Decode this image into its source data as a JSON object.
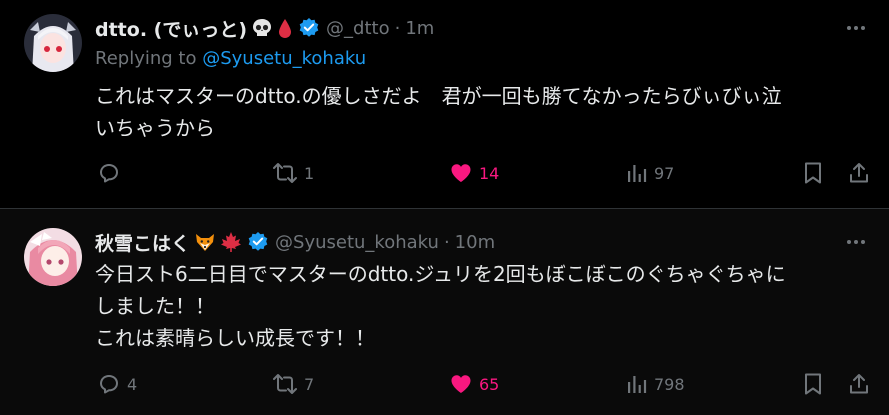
{
  "tweets": [
    {
      "author": {
        "display_name": "dtto. (でぃっと)",
        "emoji": [
          "skull-emoji",
          "blood-drop-emoji"
        ],
        "handle": "@_dtto",
        "time": "1m"
      },
      "reply_prefix": "Replying to",
      "reply_to": "@Syusetu_kohaku",
      "lines": [
        "これはマスターのdtto.の優しさだよ　君が一回も勝てなかったらびぃびぃ泣",
        "いちゃうから"
      ],
      "actions": {
        "reply": "",
        "retweet": "1",
        "like": "14",
        "views": "97"
      }
    },
    {
      "author": {
        "display_name": "秋雪こはく",
        "emoji": [
          "fox-emoji",
          "maple-leaf-emoji"
        ],
        "handle": "@Syusetu_kohaku",
        "time": "10m"
      },
      "lines": [
        "今日スト6二日目でマスターのdtto.ジュリを2回もぼこぼこのぐちゃぐちゃに",
        "しました！！",
        "これは素晴らしい成長です！！"
      ],
      "actions": {
        "reply": "4",
        "retweet": "7",
        "like": "65",
        "views": "798"
      }
    }
  ],
  "separator": "·",
  "colors": {
    "background": "#000000",
    "text": "#e7e9ea",
    "muted": "#71767b",
    "link": "#1d9bf0",
    "like": "#f91880",
    "verified": "#1d9bf0"
  }
}
